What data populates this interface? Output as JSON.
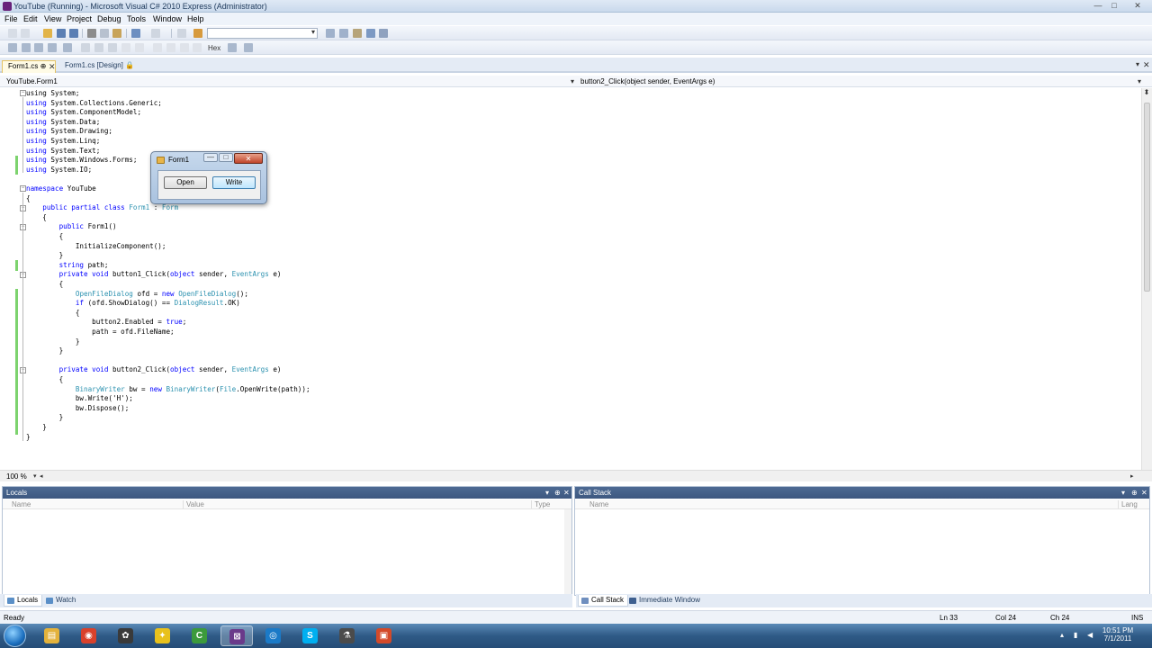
{
  "window": {
    "title": "YouTube (Running) - Microsoft Visual C# 2010 Express (Administrator)",
    "controls": {
      "minimize": "—",
      "maximize": "□",
      "close": "✕"
    }
  },
  "menu": [
    "File",
    "Edit",
    "View",
    "Project",
    "Debug",
    "Tools",
    "Window",
    "Help"
  ],
  "toolbar": {
    "hex_label": "Hex"
  },
  "tabs": {
    "active": "Form1.cs",
    "active_pin": "⊕",
    "inactive": "Form1.cs [Design]",
    "inactive_lock": "🔒",
    "close": "✕"
  },
  "navbar": {
    "type": "YouTube.Form1",
    "member": "button2_Click(object sender, EventArgs e)"
  },
  "code": [
    [
      [
        "",
        "using"
      ],
      [
        "",
        " System;"
      ]
    ],
    [
      [
        "kw",
        "using"
      ],
      [
        "",
        " System.Collections.Generic;"
      ]
    ],
    [
      [
        "kw",
        "using"
      ],
      [
        "",
        " System.ComponentModel;"
      ]
    ],
    [
      [
        "kw",
        "using"
      ],
      [
        "",
        " System.Data;"
      ]
    ],
    [
      [
        "kw",
        "using"
      ],
      [
        "",
        " System.Drawing;"
      ]
    ],
    [
      [
        "kw",
        "using"
      ],
      [
        "",
        " System.Linq;"
      ]
    ],
    [
      [
        "kw",
        "using"
      ],
      [
        "",
        " System.Text;"
      ]
    ],
    [
      [
        "kw",
        "using"
      ],
      [
        "",
        " System.Windows.Forms;"
      ]
    ],
    [
      [
        "kw",
        "using"
      ],
      [
        "",
        " System.IO;"
      ]
    ],
    [
      [
        "",
        ""
      ]
    ],
    [
      [
        "kw",
        "namespace"
      ],
      [
        "",
        " YouTube"
      ]
    ],
    [
      [
        "",
        "{"
      ]
    ],
    [
      [
        "",
        "    "
      ],
      [
        "kw",
        "public partial class"
      ],
      [
        "",
        " "
      ],
      [
        "ty",
        "Form1"
      ],
      [
        "",
        " : "
      ],
      [
        "ty",
        "Form"
      ]
    ],
    [
      [
        "",
        "    {"
      ]
    ],
    [
      [
        "",
        "        "
      ],
      [
        "kw",
        "public"
      ],
      [
        "",
        " Form1()"
      ]
    ],
    [
      [
        "",
        "        {"
      ]
    ],
    [
      [
        "",
        "            InitializeComponent();"
      ]
    ],
    [
      [
        "",
        "        }"
      ]
    ],
    [
      [
        "",
        "        "
      ],
      [
        "kw",
        "string"
      ],
      [
        "",
        " path;"
      ]
    ],
    [
      [
        "",
        "        "
      ],
      [
        "kw",
        "private void"
      ],
      [
        "",
        " button1_Click("
      ],
      [
        "kw",
        "object"
      ],
      [
        "",
        " sender, "
      ],
      [
        "ty",
        "EventArgs"
      ],
      [
        "",
        " e)"
      ]
    ],
    [
      [
        "",
        "        {"
      ]
    ],
    [
      [
        "",
        "            "
      ],
      [
        "ty",
        "OpenFileDialog"
      ],
      [
        "",
        " ofd = "
      ],
      [
        "kw",
        "new"
      ],
      [
        "",
        " "
      ],
      [
        "ty",
        "OpenFileDialog"
      ],
      [
        "",
        "();"
      ]
    ],
    [
      [
        "",
        "            "
      ],
      [
        "kw",
        "if"
      ],
      [
        "",
        " (ofd.ShowDialog() == "
      ],
      [
        "ty",
        "DialogResult"
      ],
      [
        "",
        ".OK)"
      ]
    ],
    [
      [
        "",
        "            {"
      ]
    ],
    [
      [
        "",
        "                button2.Enabled = "
      ],
      [
        "kw",
        "true"
      ],
      [
        "",
        ";"
      ]
    ],
    [
      [
        "",
        "                path = ofd.FileName;"
      ]
    ],
    [
      [
        "",
        "            }"
      ]
    ],
    [
      [
        "",
        "        }"
      ]
    ],
    [
      [
        "",
        ""
      ]
    ],
    [
      [
        "",
        "        "
      ],
      [
        "kw",
        "private void"
      ],
      [
        "",
        " button2_Click("
      ],
      [
        "kw",
        "object"
      ],
      [
        "",
        " sender, "
      ],
      [
        "ty",
        "EventArgs"
      ],
      [
        "",
        " e)"
      ]
    ],
    [
      [
        "",
        "        {"
      ]
    ],
    [
      [
        "",
        "            "
      ],
      [
        "ty",
        "BinaryWriter"
      ],
      [
        "",
        " bw = "
      ],
      [
        "kw",
        "new"
      ],
      [
        "",
        " "
      ],
      [
        "ty",
        "BinaryWriter"
      ],
      [
        "",
        "("
      ],
      [
        "ty",
        "File"
      ],
      [
        "",
        ".OpenWrite(path));"
      ]
    ],
    [
      [
        "",
        "            bw.Write('H');"
      ]
    ],
    [
      [
        "",
        "            bw.Dispose();"
      ]
    ],
    [
      [
        "",
        "        }"
      ]
    ],
    [
      [
        "",
        "    }"
      ]
    ],
    [
      [
        "",
        "}"
      ]
    ]
  ],
  "editor": {
    "zoom": "100 %"
  },
  "form1": {
    "title": "Form1",
    "open_button": "Open",
    "write_button": "Write",
    "min": "—",
    "max": "□",
    "close": "✕"
  },
  "locals": {
    "title": "Locals",
    "columns": [
      "Name",
      "Value",
      "Type"
    ],
    "ctl_dropdown": "▾",
    "ctl_pin": "⊕",
    "ctl_close": "✕"
  },
  "callstack": {
    "title": "Call Stack",
    "columns": [
      "Name",
      "Lang"
    ],
    "ctl_dropdown": "▾",
    "ctl_pin": "⊕",
    "ctl_close": "✕"
  },
  "bottom_tabs_left": [
    "Locals",
    "Watch"
  ],
  "bottom_tabs_right": [
    "Call Stack",
    "Immediate Window"
  ],
  "status": {
    "state": "Ready",
    "line": "Ln 33",
    "col": "Col 24",
    "ch": "Ch 24",
    "mode": "INS"
  },
  "taskbar": {
    "time": "10:51 PM",
    "date": "7/1/2011",
    "apps": [
      {
        "name": "explorer",
        "glyph": "▤",
        "color": "#e3b23c"
      },
      {
        "name": "chrome",
        "glyph": "◉",
        "color": "#d9412b"
      },
      {
        "name": "media",
        "glyph": "✿",
        "color": "#3a3a3a"
      },
      {
        "name": "app-figure",
        "glyph": "✦",
        "color": "#e8c11c"
      },
      {
        "name": "csharp-express",
        "glyph": "C",
        "color": "#3c9a3c"
      },
      {
        "name": "visual-studio",
        "glyph": "⊠",
        "color": "#6a3a8a"
      },
      {
        "name": "skype-blue",
        "glyph": "◎",
        "color": "#1b7ac7"
      },
      {
        "name": "skype",
        "glyph": "S",
        "color": "#00aff0"
      },
      {
        "name": "tool",
        "glyph": "⚗",
        "color": "#4b4b4b"
      },
      {
        "name": "presenter",
        "glyph": "▣",
        "color": "#d34a2a"
      }
    ]
  },
  "colors": {
    "keyword": "#0000ff",
    "type": "#2b91af",
    "change_bar": "#7dd36e",
    "toolwindow_header": "#4d6a93"
  }
}
